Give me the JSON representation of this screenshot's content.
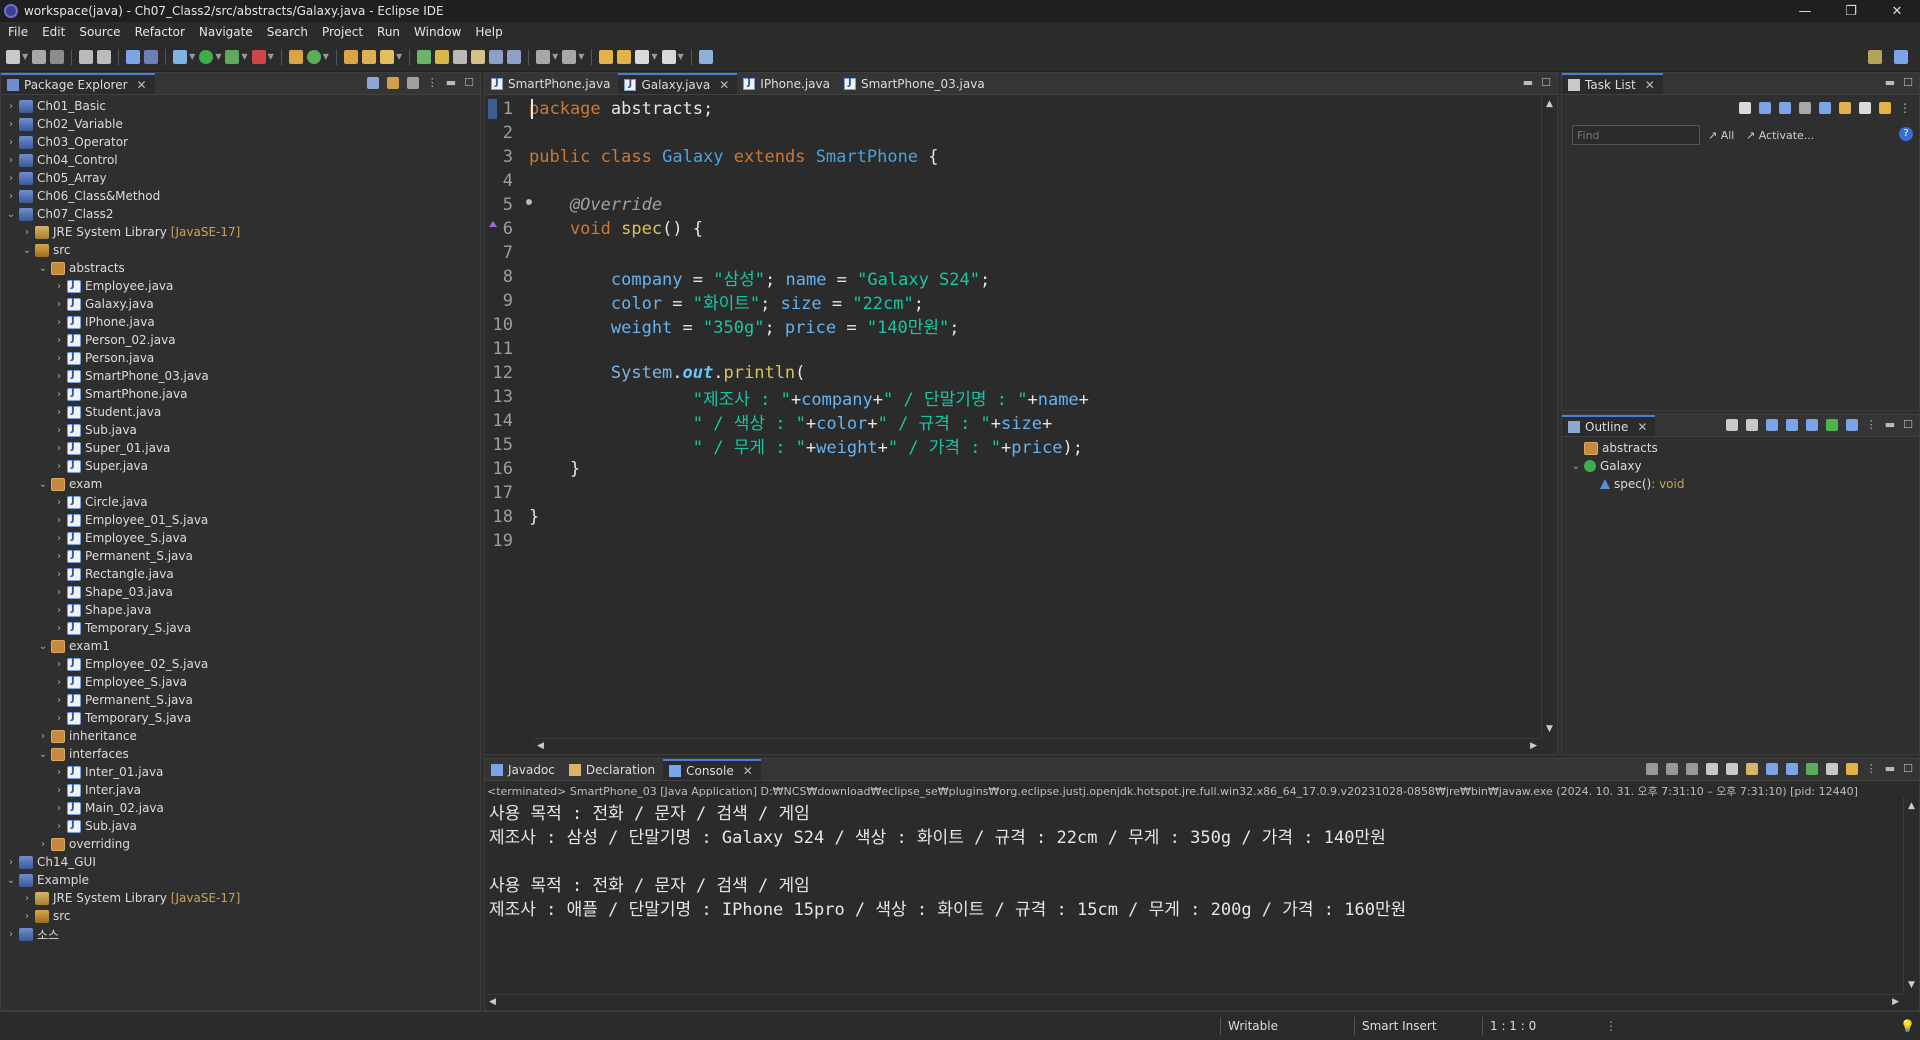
{
  "window": {
    "title": "workspace(java) - Ch07_Class2/src/abstracts/Galaxy.java - Eclipse IDE",
    "minimize_glyph": "—",
    "restore_glyph": "❐",
    "close_glyph": "✕"
  },
  "menu": [
    "File",
    "Edit",
    "Source",
    "Refactor",
    "Navigate",
    "Search",
    "Project",
    "Run",
    "Window",
    "Help"
  ],
  "package_explorer": {
    "title": "Package Explorer",
    "close_glyph": "✕",
    "tree": [
      {
        "label": "Ch01_Basic",
        "icon": "project",
        "expanded": false
      },
      {
        "label": "Ch02_Variable",
        "icon": "project",
        "expanded": false
      },
      {
        "label": "Ch03_Operator",
        "icon": "project",
        "expanded": false
      },
      {
        "label": "Ch04_Control",
        "icon": "project",
        "expanded": false
      },
      {
        "label": "Ch05_Array",
        "icon": "project",
        "expanded": false
      },
      {
        "label": "Ch06_Class&Method",
        "icon": "project",
        "expanded": false
      },
      {
        "label": "Ch07_Class2",
        "icon": "project",
        "expanded": true
      },
      {
        "label": "JRE System Library",
        "suffix": "[JavaSE-17]",
        "icon": "lib",
        "expanded": false
      },
      {
        "label": "src",
        "icon": "src",
        "expanded": true
      },
      {
        "label": "abstracts",
        "icon": "pkg",
        "expanded": true
      },
      {
        "label": "Employee.java",
        "icon": "java",
        "expanded": false
      },
      {
        "label": "Galaxy.java",
        "icon": "java",
        "expanded": false
      },
      {
        "label": "IPhone.java",
        "icon": "java",
        "expanded": false
      },
      {
        "label": "Person_02.java",
        "icon": "java",
        "expanded": false
      },
      {
        "label": "Person.java",
        "icon": "java",
        "expanded": false
      },
      {
        "label": "SmartPhone_03.java",
        "icon": "java",
        "expanded": false
      },
      {
        "label": "SmartPhone.java",
        "icon": "java",
        "expanded": false
      },
      {
        "label": "Student.java",
        "icon": "java",
        "expanded": false
      },
      {
        "label": "Sub.java",
        "icon": "java",
        "expanded": false
      },
      {
        "label": "Super_01.java",
        "icon": "java",
        "expanded": false
      },
      {
        "label": "Super.java",
        "icon": "java",
        "expanded": false
      },
      {
        "label": "exam",
        "icon": "pkg",
        "expanded": true
      },
      {
        "label": "Circle.java",
        "icon": "java",
        "expanded": false
      },
      {
        "label": "Employee_01_S.java",
        "icon": "java",
        "expanded": false
      },
      {
        "label": "Employee_S.java",
        "icon": "java",
        "expanded": false
      },
      {
        "label": "Permanent_S.java",
        "icon": "java",
        "expanded": false
      },
      {
        "label": "Rectangle.java",
        "icon": "java",
        "expanded": false
      },
      {
        "label": "Shape_03.java",
        "icon": "java",
        "expanded": false
      },
      {
        "label": "Shape.java",
        "icon": "java",
        "expanded": false
      },
      {
        "label": "Temporary_S.java",
        "icon": "java",
        "expanded": false
      },
      {
        "label": "exam1",
        "icon": "pkg",
        "expanded": true
      },
      {
        "label": "Employee_02_S.java",
        "icon": "java",
        "expanded": false
      },
      {
        "label": "Employee_S.java",
        "icon": "java",
        "expanded": false
      },
      {
        "label": "Permanent_S.java",
        "icon": "java",
        "expanded": false
      },
      {
        "label": "Temporary_S.java",
        "icon": "java",
        "expanded": false
      },
      {
        "label": "inheritance",
        "icon": "pkg",
        "expanded": false
      },
      {
        "label": "interfaces",
        "icon": "pkg",
        "expanded": true
      },
      {
        "label": "Inter_01.java",
        "icon": "java",
        "expanded": false
      },
      {
        "label": "Inter.java",
        "icon": "java",
        "expanded": false
      },
      {
        "label": "Main_02.java",
        "icon": "java",
        "expanded": false
      },
      {
        "label": "Sub.java",
        "icon": "java",
        "expanded": false
      },
      {
        "label": "overriding",
        "icon": "pkg",
        "expanded": false
      },
      {
        "label": "Ch14_GUI",
        "icon": "project",
        "expanded": false
      },
      {
        "label": "Example",
        "icon": "project",
        "expanded": true
      },
      {
        "label": "JRE System Library",
        "suffix": "[JavaSE-17]",
        "icon": "lib",
        "expanded": false
      },
      {
        "label": "src",
        "icon": "src",
        "expanded": false
      },
      {
        "label": "소스",
        "icon": "project",
        "expanded": false
      }
    ]
  },
  "editor": {
    "tabs": [
      {
        "label": "SmartPhone.java",
        "active": false
      },
      {
        "label": "Galaxy.java",
        "active": true
      },
      {
        "label": "IPhone.java",
        "active": false
      },
      {
        "label": "SmartPhone_03.java",
        "active": false
      }
    ],
    "close_glyph": "✕",
    "lines": [
      {
        "n": "1",
        "tokens": [
          [
            "kw",
            "package"
          ],
          [
            "pl",
            " abstracts;"
          ]
        ]
      },
      {
        "n": "2",
        "tokens": []
      },
      {
        "n": "3",
        "tokens": [
          [
            "kw",
            "public"
          ],
          [
            "pl",
            " "
          ],
          [
            "kw",
            "class"
          ],
          [
            "pl",
            " "
          ],
          [
            "ty",
            "Galaxy"
          ],
          [
            "pl",
            " "
          ],
          [
            "kw",
            "extends"
          ],
          [
            "pl",
            " "
          ],
          [
            "ty",
            "SmartPhone"
          ],
          [
            "pl",
            " {"
          ]
        ]
      },
      {
        "n": "4",
        "tokens": []
      },
      {
        "n": "5",
        "tokens": [
          [
            "an",
            "    @Override"
          ]
        ]
      },
      {
        "n": "6",
        "tokens": [
          [
            "kw",
            "    void"
          ],
          [
            "pl",
            " "
          ],
          [
            "mth",
            "spec"
          ],
          [
            "pl",
            "() {"
          ]
        ]
      },
      {
        "n": "7",
        "tokens": []
      },
      {
        "n": "8",
        "tokens": [
          [
            "fld",
            "        company"
          ],
          [
            "pl",
            " = "
          ],
          [
            "str",
            "\"삼성\""
          ],
          [
            "pl",
            "; "
          ],
          [
            "fld",
            "name"
          ],
          [
            "pl",
            " = "
          ],
          [
            "str",
            "\"Galaxy S24\""
          ],
          [
            "pl",
            ";"
          ]
        ]
      },
      {
        "n": "9",
        "tokens": [
          [
            "fld",
            "        color"
          ],
          [
            "pl",
            " = "
          ],
          [
            "str",
            "\"화이트\""
          ],
          [
            "pl",
            "; "
          ],
          [
            "fld",
            "size"
          ],
          [
            "pl",
            " = "
          ],
          [
            "str",
            "\"22cm\""
          ],
          [
            "pl",
            ";"
          ]
        ]
      },
      {
        "n": "10",
        "tokens": [
          [
            "fld",
            "        weight"
          ],
          [
            "pl",
            " = "
          ],
          [
            "str",
            "\"350g\""
          ],
          [
            "pl",
            "; "
          ],
          [
            "fld",
            "price"
          ],
          [
            "pl",
            " = "
          ],
          [
            "str",
            "\"140만원\""
          ],
          [
            "pl",
            ";"
          ]
        ]
      },
      {
        "n": "11",
        "tokens": []
      },
      {
        "n": "12",
        "tokens": [
          [
            "sysout",
            "        System"
          ],
          [
            "pl",
            "."
          ],
          [
            "outf",
            "out"
          ],
          [
            "pl",
            "."
          ],
          [
            "mth",
            "println"
          ],
          [
            "pl",
            "("
          ]
        ]
      },
      {
        "n": "13",
        "tokens": [
          [
            "str",
            "                \"제조사 : \""
          ],
          [
            "pl",
            "+"
          ],
          [
            "fld",
            "company"
          ],
          [
            "pl",
            "+"
          ],
          [
            "str",
            "\" / 단말기명 : \""
          ],
          [
            "pl",
            "+"
          ],
          [
            "fld",
            "name"
          ],
          [
            "pl",
            "+"
          ]
        ]
      },
      {
        "n": "14",
        "tokens": [
          [
            "str",
            "                \" / 색상 : \""
          ],
          [
            "pl",
            "+"
          ],
          [
            "fld",
            "color"
          ],
          [
            "pl",
            "+"
          ],
          [
            "str",
            "\" / 규격 : \""
          ],
          [
            "pl",
            "+"
          ],
          [
            "fld",
            "size"
          ],
          [
            "pl",
            "+"
          ]
        ]
      },
      {
        "n": "15",
        "tokens": [
          [
            "str",
            "                \" / 무게 : \""
          ],
          [
            "pl",
            "+"
          ],
          [
            "fld",
            "weight"
          ],
          [
            "pl",
            "+"
          ],
          [
            "str",
            "\" / 가격 : \""
          ],
          [
            "pl",
            "+"
          ],
          [
            "fld",
            "price"
          ],
          [
            "pl",
            ");"
          ]
        ]
      },
      {
        "n": "16",
        "tokens": [
          [
            "pl",
            "    }"
          ]
        ]
      },
      {
        "n": "17",
        "tokens": []
      },
      {
        "n": "18",
        "tokens": [
          [
            "pl",
            "}"
          ]
        ]
      },
      {
        "n": "19",
        "tokens": []
      }
    ]
  },
  "task_list": {
    "title": "Task List",
    "close_glyph": "✕",
    "find_placeholder": "Find",
    "all_label": "All",
    "activate_label": "Activate..."
  },
  "outline": {
    "title": "Outline",
    "close_glyph": "✕",
    "items": [
      {
        "label": "abstracts",
        "type": ""
      },
      {
        "label": "Galaxy",
        "type": ""
      },
      {
        "label": "spec()",
        "type": " : void"
      }
    ]
  },
  "bottom_tabs": [
    {
      "label": "Javadoc",
      "active": false
    },
    {
      "label": "Declaration",
      "active": false
    },
    {
      "label": "Console",
      "active": true
    }
  ],
  "console": {
    "terminated_line": "<terminated> SmartPhone_03 [Java Application] D:₩NCS₩download₩eclipse_se₩plugins₩org.eclipse.justj.openjdk.hotspot.jre.full.win32.x86_64_17.0.9.v20231028-0858₩jre₩bin₩javaw.exe  (2024. 10. 31. 오후 7:31:10 – 오후 7:31:10) [pid: 12440]",
    "lines": [
      "사용 목적 : 전화 / 문자 / 검색 / 게임",
      "제조사 : 삼성 / 단말기명 : Galaxy S24 / 색상 : 화이트 / 규격 : 22cm / 무게 : 350g / 가격 : 140만원",
      "",
      "사용 목적 : 전화 / 문자 / 검색 / 게임",
      "제조사 : 애플 / 단말기명 : IPhone 15pro / 색상 : 화이트 / 규격 : 15cm / 무게 : 200g / 가격 : 160만원"
    ]
  },
  "status": {
    "writable": "Writable",
    "insert_mode": "Smart Insert",
    "position": "1 : 1 : 0"
  },
  "colors": {
    "accent": "#4c7bd9",
    "keyword": "#cc7832",
    "type": "#4aa3d9",
    "string": "#17c6a3"
  }
}
